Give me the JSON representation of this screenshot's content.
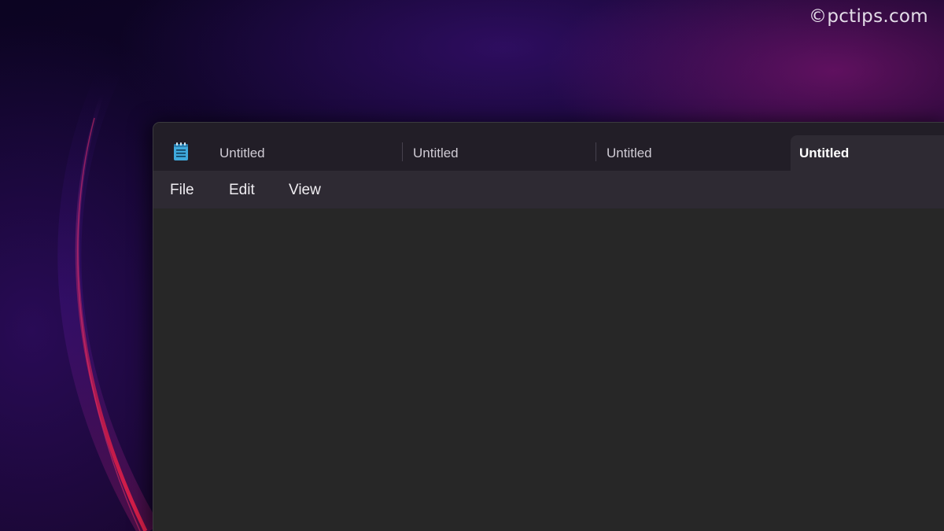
{
  "watermark": "©pctips.com",
  "window": {
    "app_icon": "notepad-icon",
    "tabs": [
      {
        "label": "Untitled",
        "active": false
      },
      {
        "label": "Untitled",
        "active": false
      },
      {
        "label": "Untitled",
        "active": false
      },
      {
        "label": "Untitled",
        "active": true
      }
    ],
    "menu": {
      "file": "File",
      "edit": "Edit",
      "view": "View"
    },
    "editor_content": ""
  },
  "colors": {
    "window_bg": "#272727",
    "titlebar_bg": "#221e27",
    "active_tab_bg": "#2e2a33",
    "menubar_bg": "#2e2a33",
    "icon_accent": "#3fa9dc"
  }
}
